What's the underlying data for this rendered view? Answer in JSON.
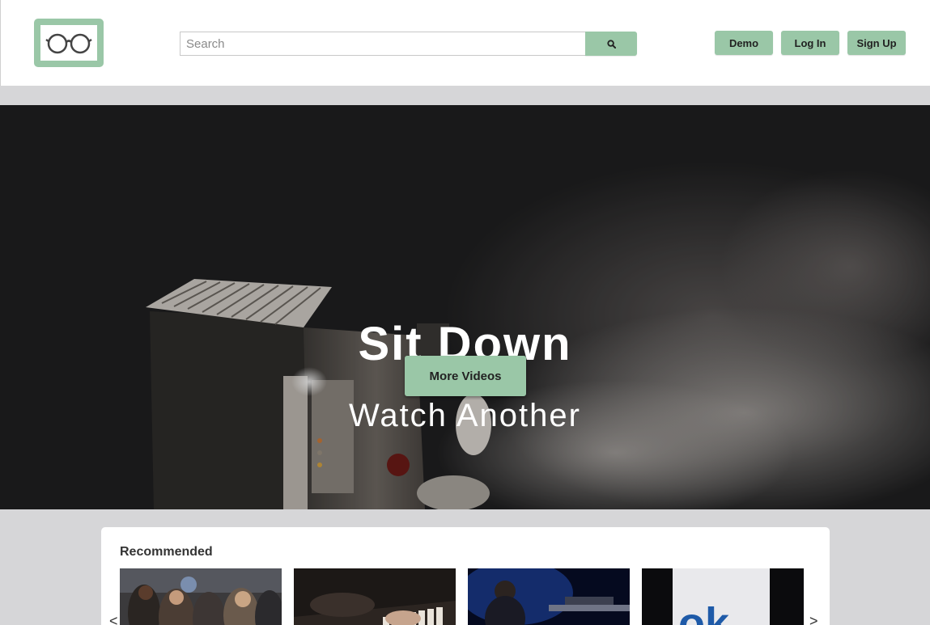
{
  "header": {
    "logo_icon": "glasses-icon",
    "search": {
      "placeholder": "Search",
      "value": "",
      "button_icon": "search-icon"
    },
    "buttons": {
      "demo": "Demo",
      "login": "Log In",
      "signup": "Sign Up"
    }
  },
  "hero": {
    "title": "Sit Down",
    "subtitle": "Watch Another",
    "cta": "More Videos"
  },
  "recommended": {
    "title": "Recommended",
    "prev_arrow": "<",
    "next_arrow": ">",
    "thumbnails": [
      {
        "icon": "video-thumbnail"
      },
      {
        "icon": "video-thumbnail"
      },
      {
        "icon": "video-thumbnail"
      },
      {
        "icon": "video-thumbnail"
      }
    ]
  },
  "colors": {
    "accent": "#9ac7a7",
    "background": "#d6d6d8",
    "hero_bg": "#1e1e1f"
  }
}
